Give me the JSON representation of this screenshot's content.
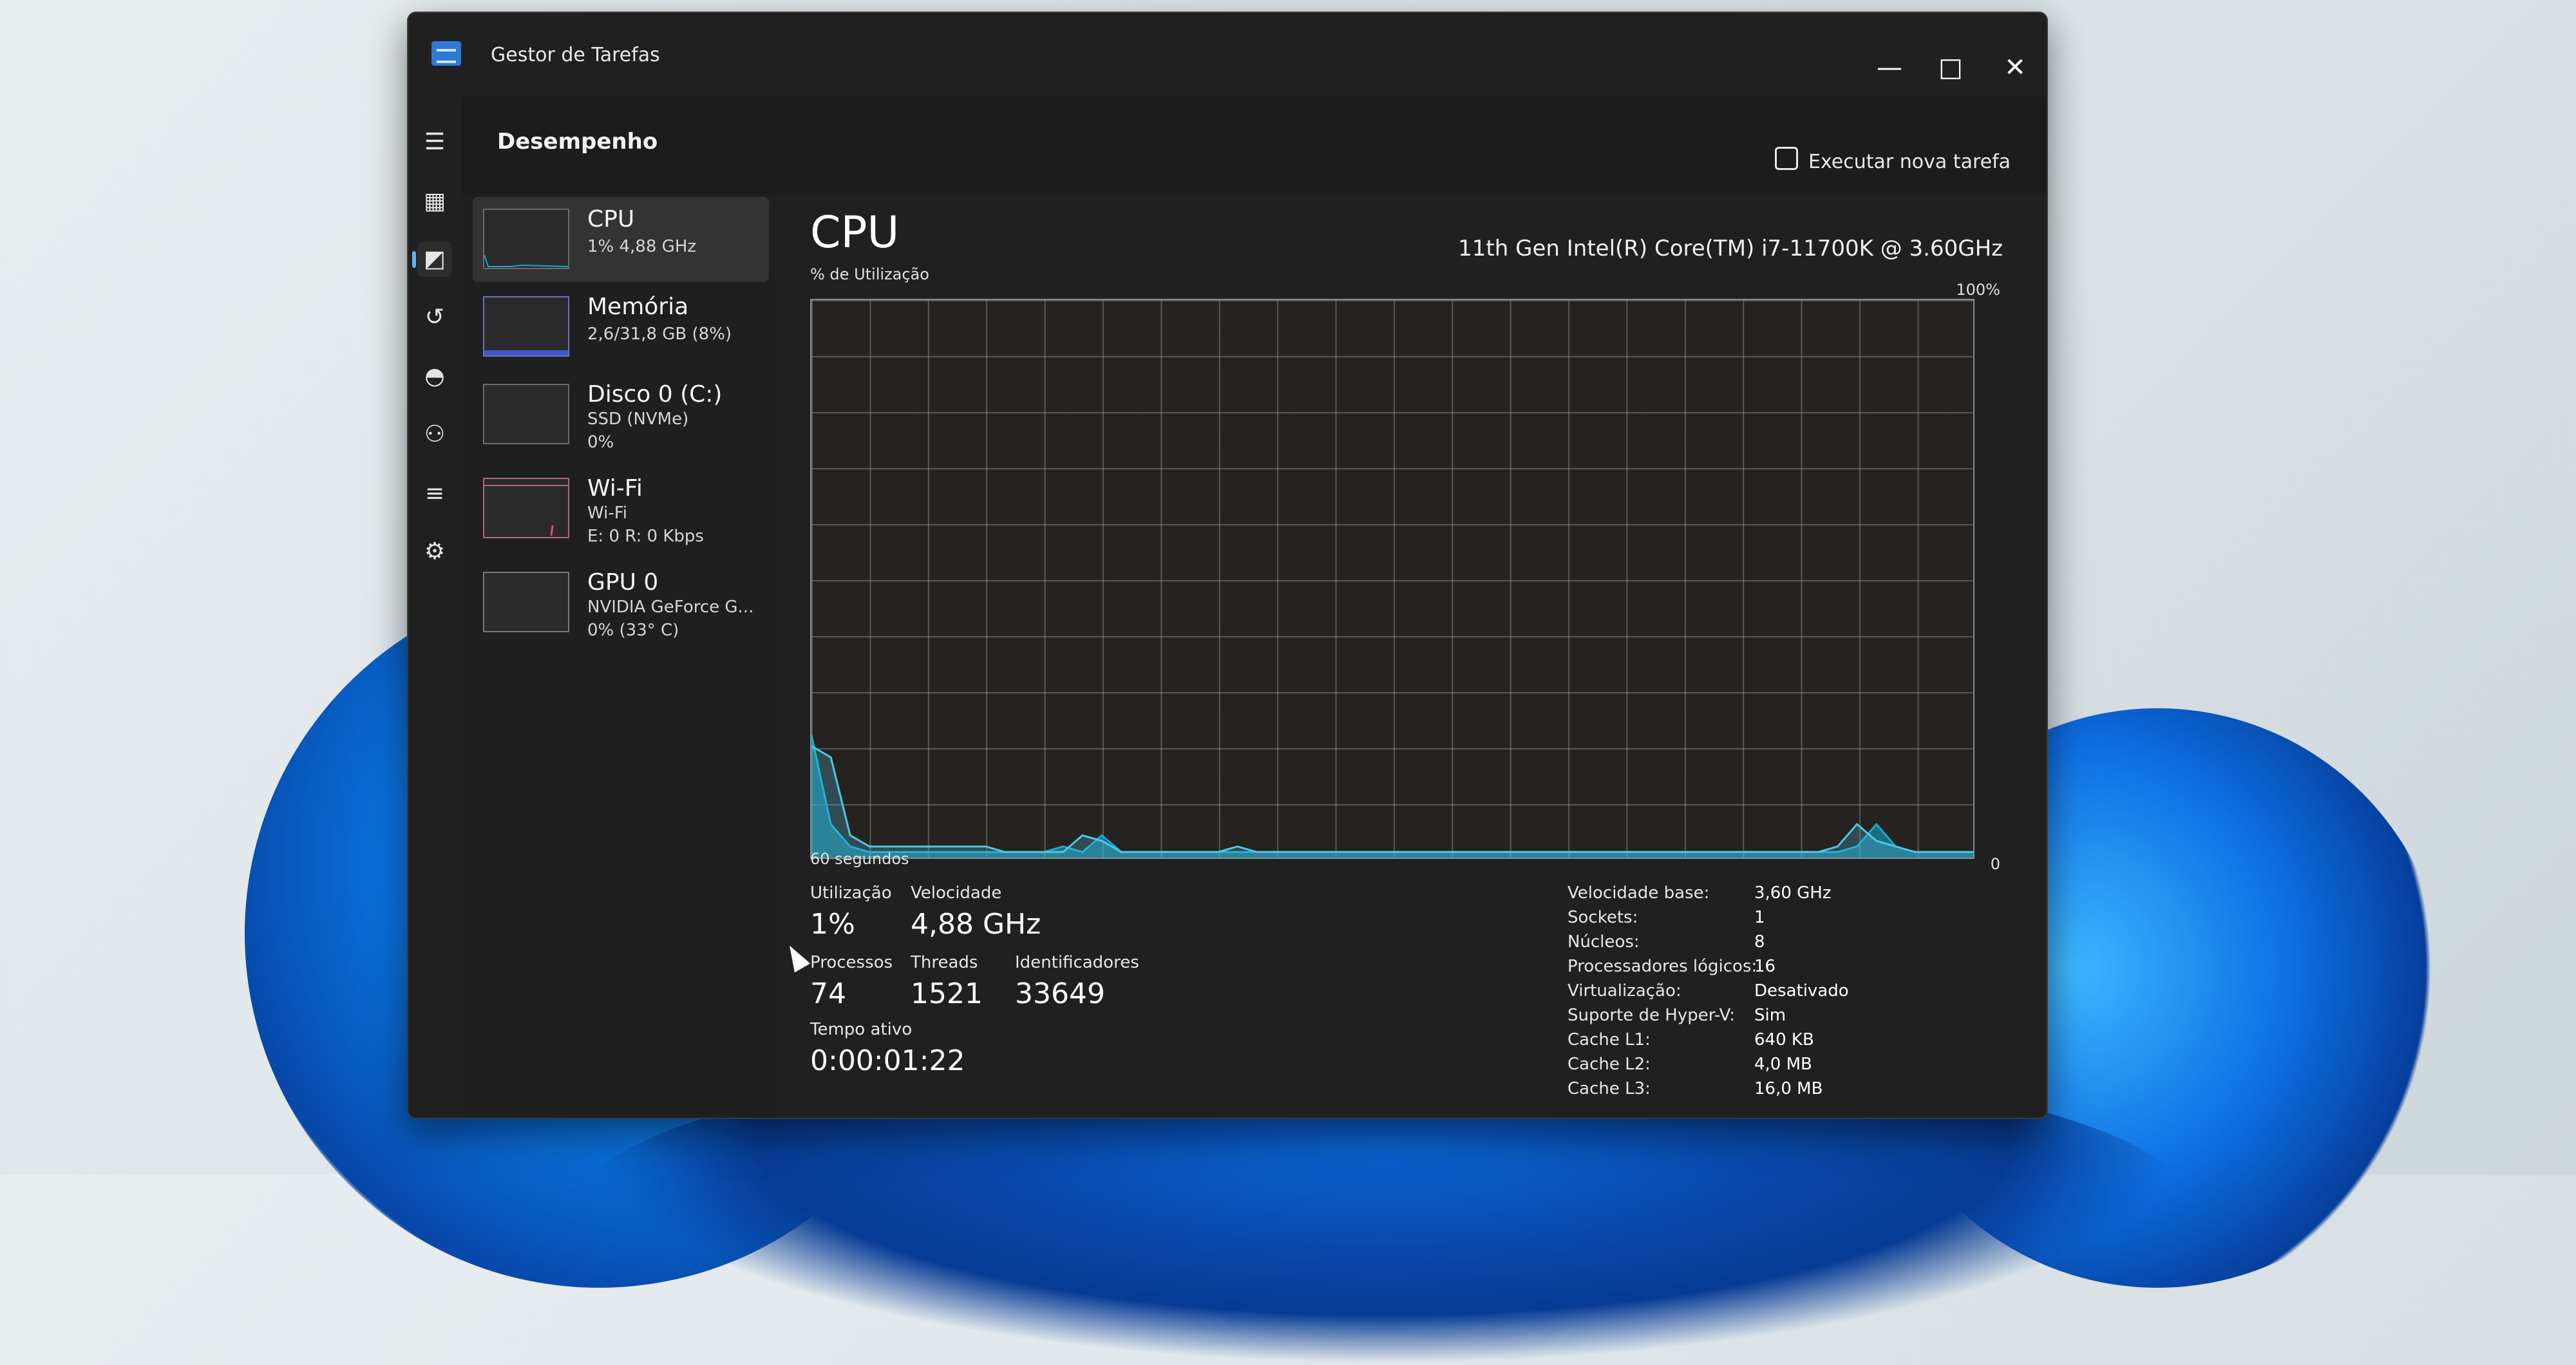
{
  "window": {
    "title": "Gestor de Tarefas",
    "minimize": "—",
    "maximize": "□",
    "close": "✕"
  },
  "rail": [
    "menu-icon",
    "processes-icon",
    "performance-icon",
    "history-icon",
    "startup-icon",
    "users-icon",
    "details-icon",
    "services-icon",
    "settings-icon"
  ],
  "header": {
    "title": "Desempenho",
    "run_task": "Executar nova tarefa",
    "more": "···"
  },
  "list": [
    {
      "title": "CPU",
      "line1": "1% 4,88 GHz",
      "line2": ""
    },
    {
      "title": "Memória",
      "line1": "2,6/31,8 GB (8%)",
      "line2": ""
    },
    {
      "title": "Disco 0 (C:)",
      "line1": "SSD (NVMe)",
      "line2": "0%"
    },
    {
      "title": "Wi-Fi",
      "line1": "Wi-Fi",
      "line2": "E: 0 R: 0 Kbps"
    },
    {
      "title": "GPU 0",
      "line1": "NVIDIA GeForce G...",
      "line2": "0% (33° C)"
    }
  ],
  "cpu": {
    "title": "CPU",
    "model": "11th Gen Intel(R) Core(TM) i7-11700K @ 3.60GHz",
    "util_label": "% de Utilização",
    "max_label": "100%",
    "min_label": "0",
    "time_label": "60 segundos"
  },
  "chart_data": {
    "type": "area",
    "ylim": [
      0,
      100
    ],
    "x_label": "60 segundos",
    "series": [
      {
        "values": [
          22,
          6,
          2,
          1,
          1,
          1,
          1,
          1,
          1,
          1,
          1,
          1,
          1,
          2,
          1,
          4,
          1,
          1,
          1,
          1,
          1,
          1,
          1,
          1,
          1,
          1,
          1,
          1,
          1,
          1,
          1,
          1,
          1,
          1,
          1,
          1,
          1,
          1,
          1,
          1,
          1,
          1,
          1,
          1,
          1,
          1,
          1,
          1,
          1,
          1,
          1,
          1,
          1,
          1,
          2,
          6,
          2,
          1,
          1,
          1,
          1
        ]
      },
      {
        "values": [
          20,
          18,
          4,
          2,
          2,
          2,
          2,
          2,
          2,
          2,
          1,
          1,
          1,
          1,
          4,
          3,
          1,
          1,
          1,
          1,
          1,
          1,
          2,
          1,
          1,
          1,
          1,
          1,
          1,
          1,
          1,
          1,
          1,
          1,
          1,
          1,
          1,
          1,
          1,
          1,
          1,
          1,
          1,
          1,
          1,
          1,
          1,
          1,
          1,
          1,
          1,
          1,
          1,
          2,
          6,
          3,
          2,
          1,
          1,
          1,
          1
        ]
      }
    ],
    "colors": [
      "#17a9d0",
      "#4fc6e6"
    ]
  },
  "stats": {
    "util_label": "Utilização",
    "util_value": "1%",
    "speed_label": "Velocidade",
    "speed_value": "4,88 GHz",
    "proc_label": "Processos",
    "proc_value": "74",
    "threads_label": "Threads",
    "threads_value": "1521",
    "handles_label": "Identificadores",
    "handles_value": "33649",
    "uptime_label": "Tempo ativo",
    "uptime_value": "0:00:01:22"
  },
  "info": [
    {
      "label": "Velocidade base:",
      "value": "3,60 GHz"
    },
    {
      "label": "Sockets:",
      "value": "1"
    },
    {
      "label": "Núcleos:",
      "value": "8"
    },
    {
      "label": "Processadores lógicos:",
      "value": "16"
    },
    {
      "label": "Virtualização:",
      "value": "Desativado"
    },
    {
      "label": "Suporte de Hyper-V:",
      "value": "Sim"
    },
    {
      "label": "Cache L1:",
      "value": "640 KB"
    },
    {
      "label": "Cache L2:",
      "value": "4,0 MB"
    },
    {
      "label": "Cache L3:",
      "value": "16,0 MB"
    }
  ]
}
